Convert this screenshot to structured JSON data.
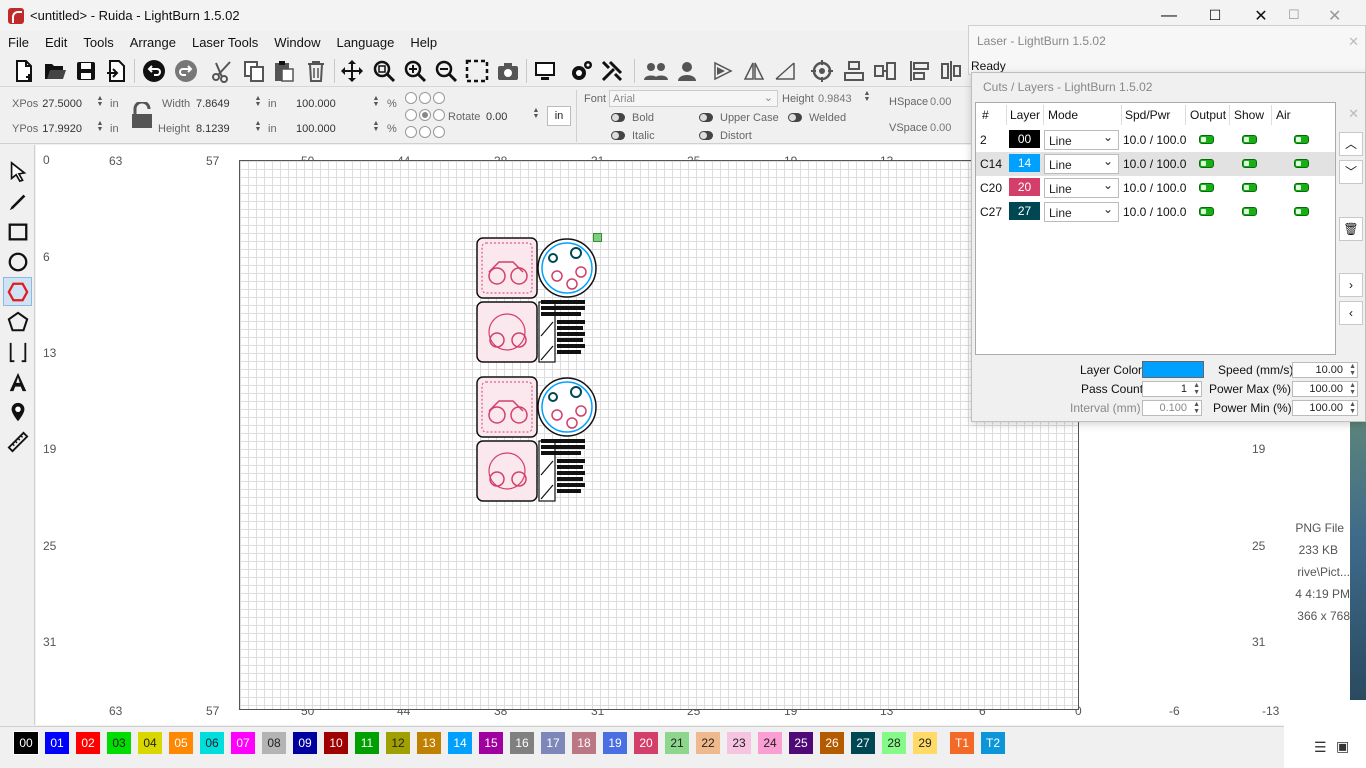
{
  "window": {
    "title": "<untitled> - Ruida - LightBurn 1.5.02",
    "minimize": "—",
    "maximize": "☐",
    "close": "✕"
  },
  "menu": [
    "File",
    "Edit",
    "Tools",
    "Arrange",
    "Laser Tools",
    "Window",
    "Language",
    "Help"
  ],
  "numeric": {
    "xpos_label": "XPos",
    "xpos": "27.5000",
    "ypos_label": "YPos",
    "ypos": "17.9920",
    "unit_in": "in",
    "width_label": "Width",
    "width": "7.8649",
    "height_label": "Height",
    "height": "8.1239",
    "pct_w": "100.000",
    "pct_h": "100.000",
    "pct": "%",
    "rotate_label": "Rotate",
    "rotate": "0.00",
    "units_button": "in"
  },
  "font": {
    "font_label": "Font",
    "font_value": "Arial",
    "height_label": "Height",
    "height_value": "0.9843",
    "hspace_label": "HSpace",
    "hspace_value": "0.00",
    "vspace_label": "VSpace",
    "vspace_value": "0.00",
    "bold": "Bold",
    "italic": "Italic",
    "upper_case": "Upper Case",
    "distort": "Distort",
    "welded": "Welded"
  },
  "rulers": {
    "top": [
      "63",
      "57",
      "50",
      "44",
      "38",
      "31",
      "25",
      "19",
      "13",
      "6",
      "0"
    ],
    "bottom": [
      "63",
      "57",
      "50",
      "44",
      "38",
      "31",
      "25",
      "19",
      "13",
      "6",
      "0",
      "-6",
      "-13"
    ],
    "left": [
      "0",
      "6",
      "13",
      "19",
      "25",
      "31"
    ],
    "right": [
      "19",
      "25",
      "31"
    ]
  },
  "palette": [
    {
      "label": "00",
      "color": "#000000"
    },
    {
      "label": "01",
      "color": "#0000ff"
    },
    {
      "label": "02",
      "color": "#ff0000"
    },
    {
      "label": "03",
      "color": "#00dd00"
    },
    {
      "label": "04",
      "color": "#d8d800"
    },
    {
      "label": "05",
      "color": "#ff8800"
    },
    {
      "label": "06",
      "color": "#00dddd"
    },
    {
      "label": "07",
      "color": "#ff00ff"
    },
    {
      "label": "08",
      "color": "#b4b4b4"
    },
    {
      "label": "09",
      "color": "#0000a0"
    },
    {
      "label": "10",
      "color": "#a00000"
    },
    {
      "label": "11",
      "color": "#00a000"
    },
    {
      "label": "12",
      "color": "#a0a000"
    },
    {
      "label": "13",
      "color": "#c08000"
    },
    {
      "label": "14",
      "color": "#00a0ff"
    },
    {
      "label": "15",
      "color": "#a000a0"
    },
    {
      "label": "16",
      "color": "#808080"
    },
    {
      "label": "17",
      "color": "#7d87b9"
    },
    {
      "label": "18",
      "color": "#bb7784"
    },
    {
      "label": "19",
      "color": "#4a6fe3"
    },
    {
      "label": "20",
      "color": "#d33f6a"
    },
    {
      "label": "21",
      "color": "#8cd78c"
    },
    {
      "label": "22",
      "color": "#f0b98d"
    },
    {
      "label": "23",
      "color": "#f6c4e1"
    },
    {
      "label": "24",
      "color": "#fa9ed4"
    },
    {
      "label": "25",
      "color": "#500a78"
    },
    {
      "label": "26",
      "color": "#b45a00"
    },
    {
      "label": "27",
      "color": "#004754"
    },
    {
      "label": "28",
      "color": "#86fa88"
    },
    {
      "label": "29",
      "color": "#ffdb66"
    },
    {
      "label": "T1",
      "color": "#f36926"
    },
    {
      "label": "T2",
      "color": "#0c96d9"
    }
  ],
  "laser_window": {
    "title": "Laser - LightBurn 1.5.02",
    "status": "Ready"
  },
  "cuts_window": {
    "title": "Cuts / Layers - LightBurn 1.5.02",
    "headers": [
      "#",
      "Layer",
      "Mode",
      "Spd/Pwr",
      "Output",
      "Show",
      "Air"
    ],
    "rows": [
      {
        "num": "2",
        "layer": "00",
        "color": "#000000",
        "mode": "Line",
        "spdpwr": "10.0 / 100.0"
      },
      {
        "num": "C14",
        "layer": "14",
        "color": "#00a0ff",
        "mode": "Line",
        "spdpwr": "10.0 / 100.0"
      },
      {
        "num": "C20",
        "layer": "20",
        "color": "#d33f6a",
        "mode": "Line",
        "spdpwr": "10.0 / 100.0"
      },
      {
        "num": "C27",
        "layer": "27",
        "color": "#004754",
        "mode": "Line",
        "spdpwr": "10.0 / 100.0"
      }
    ],
    "layer_color_label": "Layer Color",
    "layer_color": "#00a0ff",
    "speed_label": "Speed (mm/s)",
    "speed": "10.00",
    "pass_count_label": "Pass Count",
    "pass_count": "1",
    "power_max_label": "Power Max (%)",
    "power_max": "100.00",
    "interval_label": "Interval (mm)",
    "interval": "0.100",
    "power_min_label": "Power Min (%)",
    "power_min": "100.00"
  },
  "desktop_info": {
    "type": "PNG File",
    "size": "233 KB",
    "path": "rive\\Pict...",
    "time": "4 4:19 PM",
    "dims": "366 x 768"
  }
}
